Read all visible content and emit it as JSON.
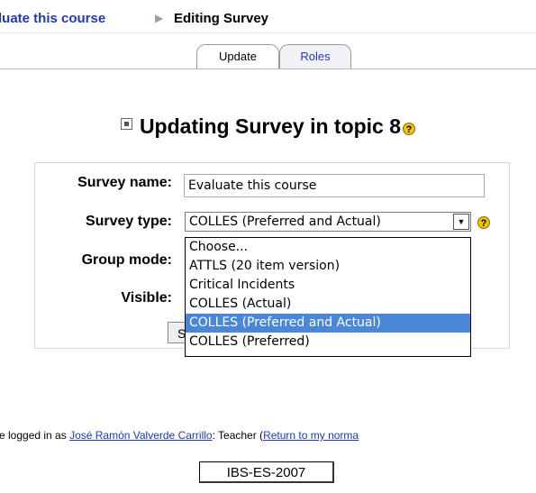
{
  "breadcrumb": {
    "link": "luate this course",
    "separator": "▶",
    "current": "Editing Survey"
  },
  "tabs": [
    {
      "label": "Update"
    },
    {
      "label": "Roles"
    }
  ],
  "heading": {
    "title": "Updating Survey in topic 8",
    "help_glyph": "?"
  },
  "form": {
    "name_label": "Survey name:",
    "name_value": "Evaluate this course",
    "type_label": "Survey type:",
    "type_value": "COLLES (Preferred and Actual)",
    "type_help_glyph": "?",
    "group_label": "Group mode:",
    "visible_label": "Visible:",
    "save_fragment": "S",
    "options": [
      "Choose...",
      "ATTLS (20 item version)",
      "Critical Incidents",
      "COLLES (Actual)",
      "COLLES (Preferred and Actual)",
      "COLLES (Preferred)"
    ],
    "selected_option_index": 4
  },
  "footer": {
    "logged_prefix": "e logged in as ",
    "user": "José Ramón Valverde Carrillo",
    "role": ": Teacher (",
    "return_link": "Return to my norma",
    "home_button": "IBS-ES-2007"
  },
  "colors": {
    "link": "#1e39b2",
    "selected_option": "#4a87d6",
    "help_icon": "#f3c300"
  }
}
